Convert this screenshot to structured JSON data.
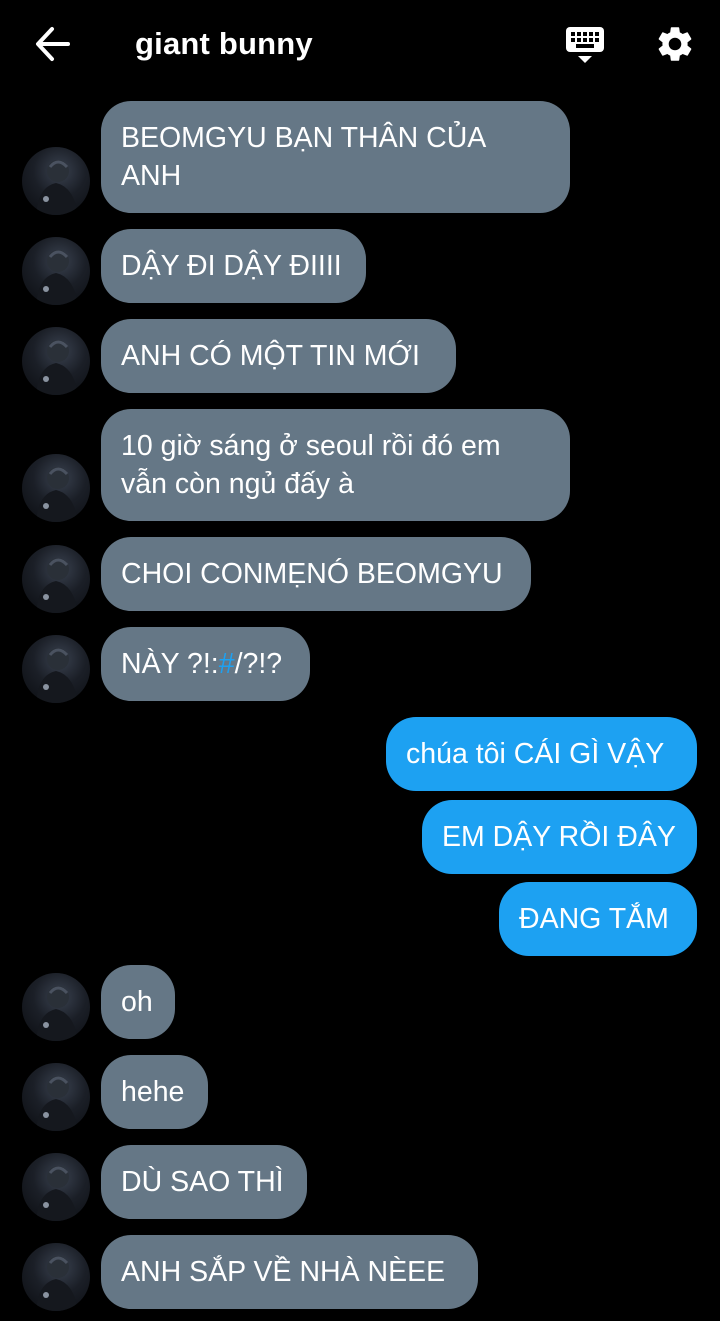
{
  "header": {
    "title": "giant bunny",
    "back_icon": "arrow-left-icon",
    "keyboard_icon": "keyboard-icon",
    "settings_icon": "gear-icon"
  },
  "colors": {
    "background": "#000000",
    "incoming_bubble": "#657786",
    "outgoing_bubble": "#1da1f2",
    "hashtag": "#1da1f2"
  },
  "messages": [
    {
      "side": "in",
      "text": "BEOMGYU BẠN THÂN CỦA ANH"
    },
    {
      "side": "in",
      "text": "DẬY ĐI DẬY ĐIIII"
    },
    {
      "side": "in",
      "text": "ANH CÓ MỘT TIN MỚI"
    },
    {
      "side": "in",
      "text": "10 giờ sáng ở seoul rồi đó em vẫn còn ngủ đấy à"
    },
    {
      "side": "in",
      "text": "CHOI CONMẸNÓ BEOMGYU"
    },
    {
      "side": "in",
      "text_before": "NÀY ?!:",
      "text_hash": "#",
      "text_after": "/?!?"
    },
    {
      "side": "out",
      "text": "chúa tôi CÁI GÌ VẬY"
    },
    {
      "side": "out",
      "text": "EM DẬY RỒI ĐÂY"
    },
    {
      "side": "out",
      "text": "ĐANG TẮM"
    },
    {
      "side": "in",
      "text": "oh"
    },
    {
      "side": "in",
      "text": "hehe"
    },
    {
      "side": "in",
      "text": "DÙ SAO THÌ"
    },
    {
      "side": "in",
      "text": "ANH SẮP VỀ NHÀ NÈEE"
    }
  ]
}
